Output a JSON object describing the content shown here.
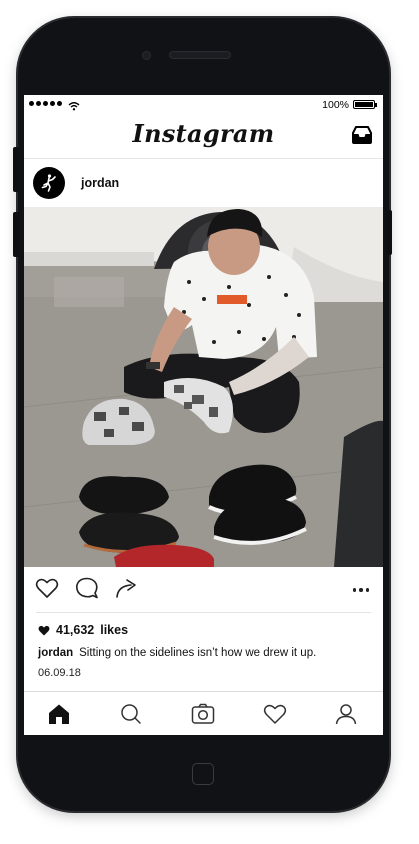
{
  "status_bar": {
    "battery_percent": "100%"
  },
  "app": {
    "title": "Instagram"
  },
  "post": {
    "username": "jordan",
    "likes_count": "41,632",
    "likes_label": "likes",
    "caption_user": "jordan",
    "caption_text": "Sitting on the sidelines isn’t how we drew it up.",
    "date": "06.09.18"
  },
  "icons": {
    "header": [
      "inbox-icon"
    ],
    "actions": [
      "like-heart-icon",
      "comment-icon",
      "share-icon",
      "more-options-icon"
    ],
    "tabbar": [
      "home-icon",
      "search-icon",
      "camera-icon",
      "activity-heart-icon",
      "profile-icon"
    ]
  },
  "colors": {
    "screen_bg": "#ffffff",
    "phone_body": "#111215",
    "text": "#111111"
  }
}
